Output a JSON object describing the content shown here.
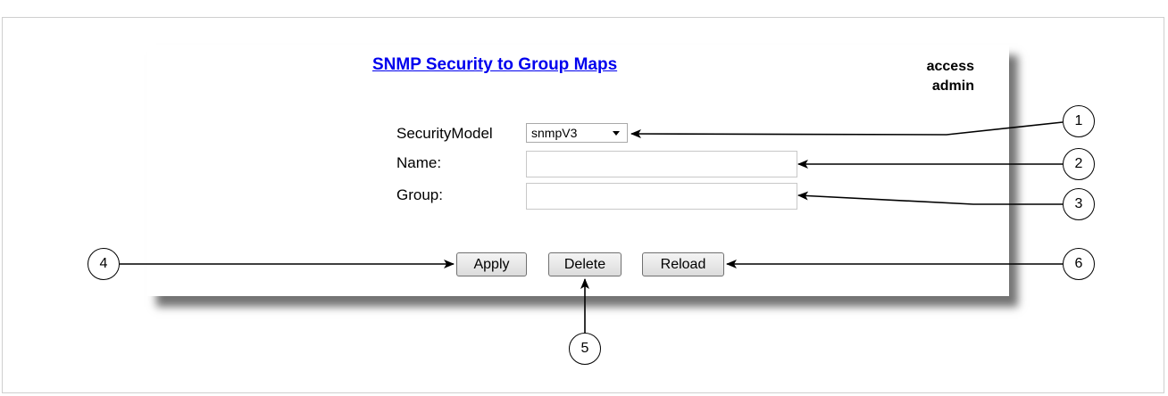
{
  "page": {
    "title": "SNMP Security to Group Maps",
    "access_label": "access",
    "access_value": "admin"
  },
  "form": {
    "security_model_label": "SecurityModel",
    "security_model_value": "snmpV3",
    "name_label": "Name:",
    "name_value": "",
    "group_label": "Group:",
    "group_value": ""
  },
  "buttons": {
    "apply": "Apply",
    "delete": "Delete",
    "reload": "Reload"
  },
  "callouts": [
    "1",
    "2",
    "3",
    "4",
    "5",
    "6"
  ]
}
